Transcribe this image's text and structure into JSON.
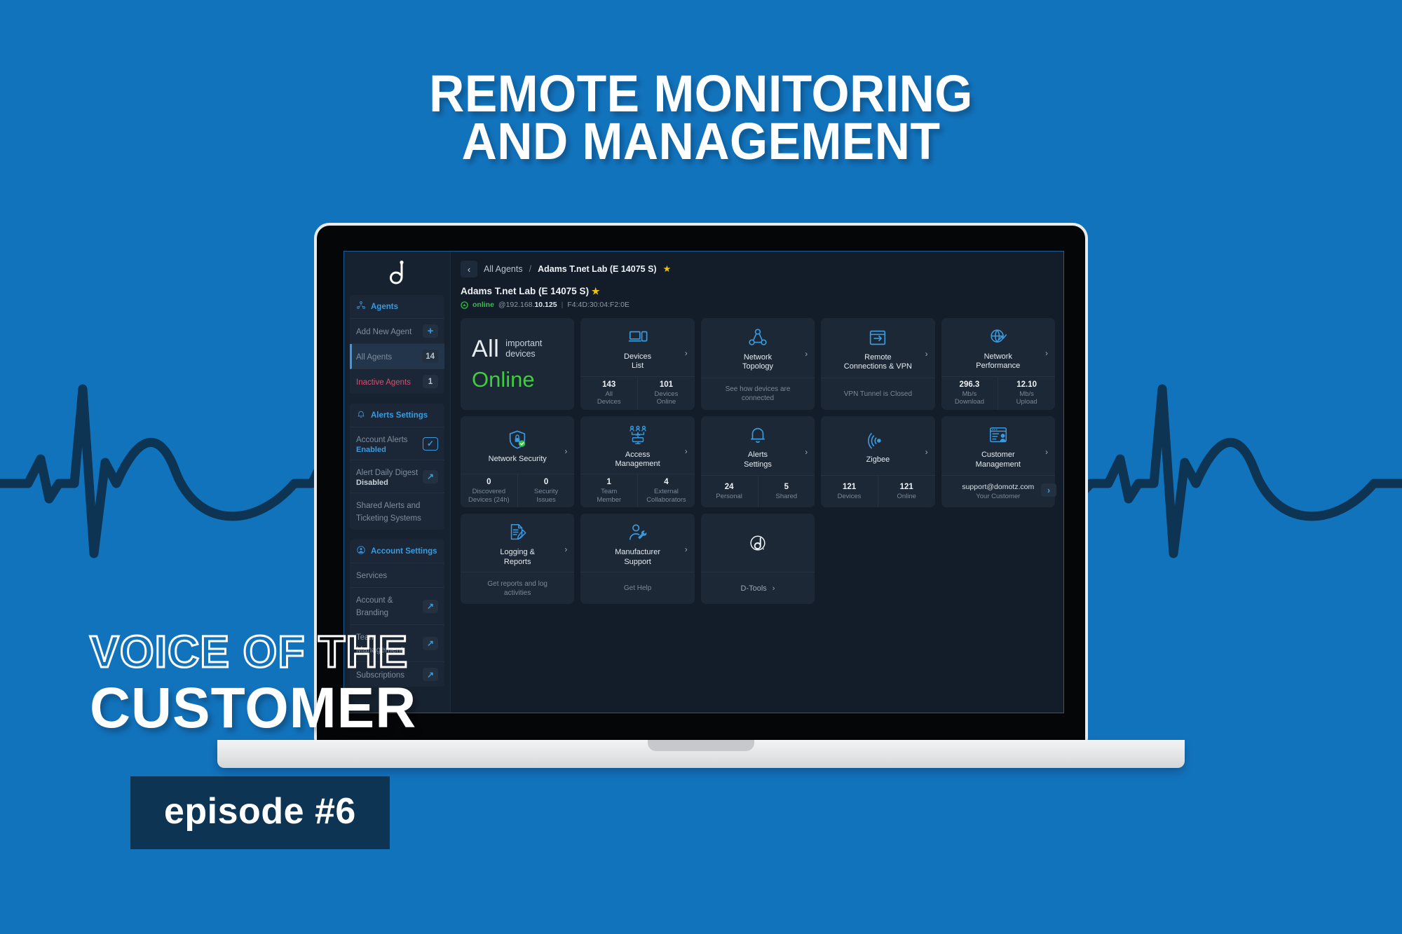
{
  "poster": {
    "headline_line1": "REMOTE MONITORING",
    "headline_line2": "AND MANAGEMENT",
    "series_line1": "VOICE OF THE",
    "series_line2": "CUSTOMER",
    "episode": "episode #6",
    "background_color": "#1273bd",
    "ecg_color": "#0d3553",
    "badge_color": "#0d3553"
  },
  "app": {
    "brand": "domotz-logo",
    "sidebar": {
      "groups": [
        {
          "head": {
            "label": "Agents",
            "icon": "agents-icon"
          },
          "rows": [
            {
              "label": "Add New Agent",
              "badge": "+",
              "badge_type": "plus",
              "active": false
            },
            {
              "label": "All Agents",
              "badge": "14",
              "badge_type": "count",
              "active": true
            },
            {
              "label": "Inactive Agents",
              "badge": "1",
              "badge_type": "count",
              "active": false,
              "danger": true
            }
          ]
        },
        {
          "head": {
            "label": "Alerts Settings",
            "icon": "bell-icon"
          },
          "rows": [
            {
              "label": "Account Alerts",
              "sub": "Enabled",
              "sub_state": "on",
              "badge": "✓",
              "badge_type": "chk"
            },
            {
              "label": "Alert Daily Digest",
              "sub": "Disabled",
              "sub_state": "off",
              "badge": "↗",
              "badge_type": "arrow"
            },
            {
              "label": "Shared Alerts and Ticketing Systems",
              "badge": "›",
              "badge_type": "chev"
            }
          ]
        },
        {
          "head": {
            "label": "Account Settings",
            "icon": "account-icon"
          },
          "rows": [
            {
              "label": "Services",
              "badge": "›",
              "badge_type": "chev"
            },
            {
              "label": "Account & Branding",
              "badge": "↗",
              "badge_type": "arrow"
            },
            {
              "label": "Team Management",
              "badge": "↗",
              "badge_type": "arrow"
            },
            {
              "label": "Subscriptions",
              "badge": "↗",
              "badge_type": "arrow"
            }
          ]
        }
      ]
    },
    "breadcrumb": {
      "back_icon": "‹",
      "parent": "All Agents",
      "separator": "/",
      "current": "Adams T.net Lab (E 14075 S)",
      "star": "★"
    },
    "header": {
      "title": "Adams T.net Lab (E 14075 S)",
      "star": "★",
      "status": "online",
      "status_color": "#2fc34a",
      "ip_prefix": "@192.168.",
      "ip_bold": "10.125",
      "divider": "|",
      "mac": "F4:4D:30:04:F2:0E"
    },
    "cards": [
      {
        "kind": "all-devices",
        "big": "All",
        "words_line1": "important",
        "words_line2": "devices",
        "status": "Online",
        "status_color": "#3fcc3f"
      },
      {
        "kind": "stats",
        "icon": "devices-list-icon",
        "title_line1": "Devices",
        "title_line2": "List",
        "chevron": "›",
        "stats": [
          {
            "num": "143",
            "label_line1": "All",
            "label_line2": "Devices"
          },
          {
            "num": "101",
            "label_line1": "Devices",
            "label_line2": "Online"
          }
        ]
      },
      {
        "kind": "text",
        "icon": "network-topology-icon",
        "title_line1": "Network",
        "title_line2": "Topology",
        "chevron": "›",
        "foot_line1": "See how devices are",
        "foot_line2": "connected"
      },
      {
        "kind": "text",
        "icon": "remote-vpn-icon",
        "title_line1": "Remote",
        "title_line2": "Connections & VPN",
        "chevron": "›",
        "foot_line1": "VPN Tunnel is Closed",
        "foot_line2": ""
      },
      {
        "kind": "stats",
        "icon": "network-performance-icon",
        "title_line1": "Network",
        "title_line2": "Performance",
        "chevron": "›",
        "stats": [
          {
            "num": "296.3",
            "label_line1": "Mb/s",
            "label_line2": "Download"
          },
          {
            "num": "12.10",
            "label_line1": "Mb/s",
            "label_line2": "Upload"
          }
        ]
      },
      {
        "kind": "stats",
        "icon": "network-security-icon",
        "title_line1": "Network Security",
        "title_line2": "",
        "chevron": "›",
        "stats": [
          {
            "num": "0",
            "label_line1": "Discovered",
            "label_line2": "Devices (24h)"
          },
          {
            "num": "0",
            "label_line1": "Security",
            "label_line2": "Issues"
          }
        ]
      },
      {
        "kind": "stats",
        "icon": "access-management-icon",
        "title_line1": "Access",
        "title_line2": "Management",
        "chevron": "›",
        "stats": [
          {
            "num": "1",
            "label_line1": "Team",
            "label_line2": "Member"
          },
          {
            "num": "4",
            "label_line1": "External",
            "label_line2": "Collaborators"
          }
        ]
      },
      {
        "kind": "stats",
        "icon": "alerts-bell-icon",
        "title_line1": "Alerts",
        "title_line2": "Settings",
        "chevron": "›",
        "stats": [
          {
            "num": "24",
            "label_line1": "Personal",
            "label_line2": ""
          },
          {
            "num": "5",
            "label_line1": "Shared",
            "label_line2": ""
          }
        ]
      },
      {
        "kind": "stats",
        "icon": "zigbee-icon",
        "title_line1": "Zigbee",
        "title_line2": "",
        "chevron": "›",
        "stats": [
          {
            "num": "121",
            "label_line1": "Devices",
            "label_line2": ""
          },
          {
            "num": "121",
            "label_line1": "Online",
            "label_line2": ""
          }
        ]
      },
      {
        "kind": "customer",
        "icon": "customer-management-icon",
        "title_line1": "Customer",
        "title_line2": "Management",
        "chevron": "›",
        "email": "support@domotz.com",
        "sub": "Your Customer"
      },
      {
        "kind": "text",
        "icon": "logging-reports-icon",
        "title_line1": "Logging &",
        "title_line2": "Reports",
        "chevron": "›",
        "foot_line1": "Get reports and log",
        "foot_line2": "activities"
      },
      {
        "kind": "text",
        "icon": "manufacturer-support-icon",
        "title_line1": "Manufacturer",
        "title_line2": "Support",
        "chevron": "›",
        "foot_line1": "Get Help",
        "foot_line2": ""
      },
      {
        "kind": "dtools",
        "icon": "dtools-logo-icon",
        "foot_label": "D-Tools",
        "chevron": "›"
      }
    ]
  }
}
